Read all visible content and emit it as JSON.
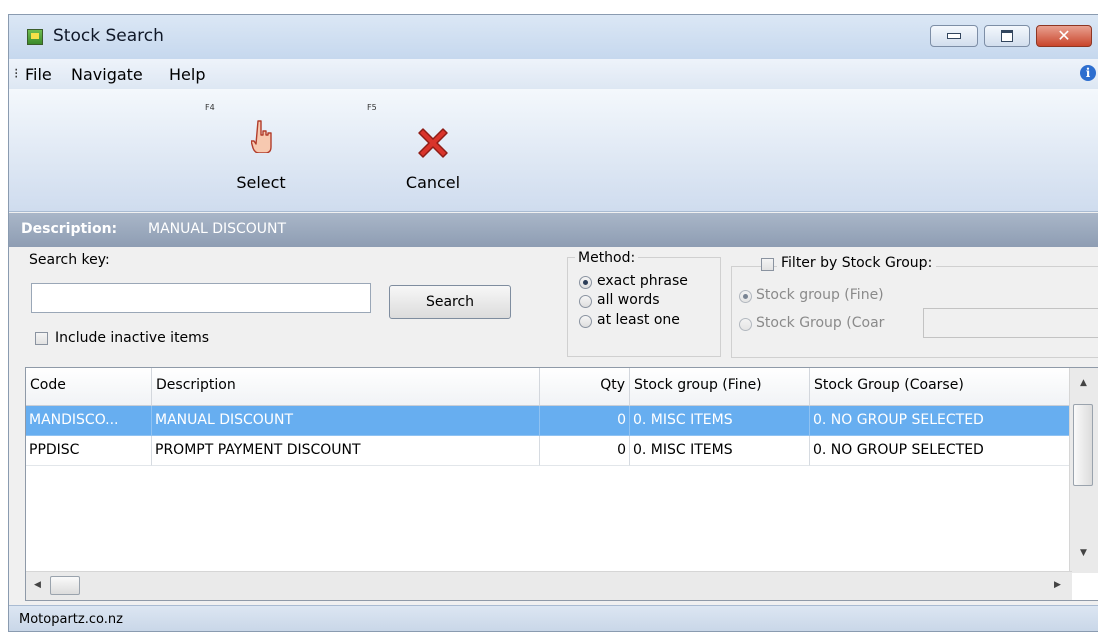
{
  "window": {
    "title": "Stock Search"
  },
  "menu": {
    "items": [
      "File",
      "Navigate",
      "Help"
    ]
  },
  "toolbar": {
    "select": {
      "key": "F4",
      "label": "Select"
    },
    "cancel": {
      "key": "F5",
      "label": "Cancel"
    }
  },
  "description": {
    "label": "Description:",
    "value": "MANUAL DISCOUNT"
  },
  "search": {
    "key_label": "Search key:",
    "value": "",
    "button_label": "Search",
    "include_inactive_label": "Include inactive items",
    "include_inactive_checked": false
  },
  "method": {
    "title": "Method:",
    "options": [
      "exact phrase",
      "all words",
      "at least one"
    ],
    "selected": "exact phrase"
  },
  "filter": {
    "label": "Filter by Stock Group:",
    "checked": false,
    "options": [
      "Stock group (Fine)",
      "Stock Group (Coar"
    ],
    "selected": "Stock group (Fine)"
  },
  "table": {
    "columns": [
      "Code",
      "Description",
      "Qty",
      "Stock group (Fine)",
      "Stock Group (Coarse)"
    ],
    "rows": [
      {
        "code": "MANDISCO...",
        "description": "MANUAL DISCOUNT",
        "qty": "0",
        "fine": "0. MISC ITEMS",
        "coarse": "0. NO GROUP SELECTED",
        "selected": true
      },
      {
        "code": "PPDISC",
        "description": "PROMPT PAYMENT DISCOUNT",
        "qty": "0",
        "fine": "0. MISC ITEMS",
        "coarse": "0. NO GROUP SELECTED",
        "selected": false
      }
    ]
  },
  "status": {
    "text": "Motopartz.co.nz"
  },
  "colors": {
    "selection": "#67aef0",
    "header_bar": "#9aa8bc",
    "close_button": "#c9462c"
  }
}
